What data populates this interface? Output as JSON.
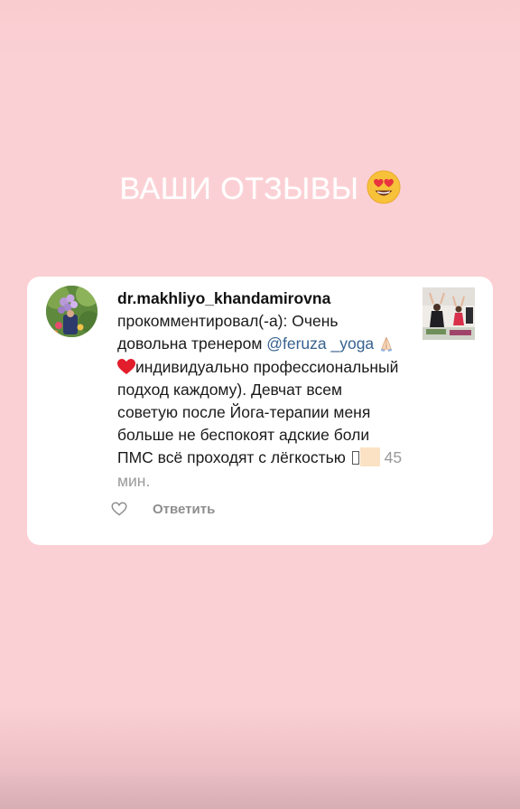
{
  "story": {
    "heading": "ВАШИ ОТЗЫВЫ",
    "heading_emoji": "heart-eyes-face-icon",
    "background_color": "#fbd0d4"
  },
  "comment": {
    "username": "dr.makhliyo_khandamirovna",
    "text_before_mention": " прокомментировал(-а): Очень довольна тренером ",
    "mention": "@feruza _yoga",
    "text_after_mention": "индивидуально профессиональный подход каждому). Девчат всем советую после Йога-терапии меня больше не беспокоят адские боли ПМС всё проходят  с лёгкостью ",
    "emojis": [
      "folded-hands-icon",
      "red-heart-icon"
    ],
    "time": "45 мин.",
    "mention_color": "#37618f"
  },
  "actions": {
    "like_icon": "heart-outline-icon",
    "reply_label": "Ответить"
  }
}
